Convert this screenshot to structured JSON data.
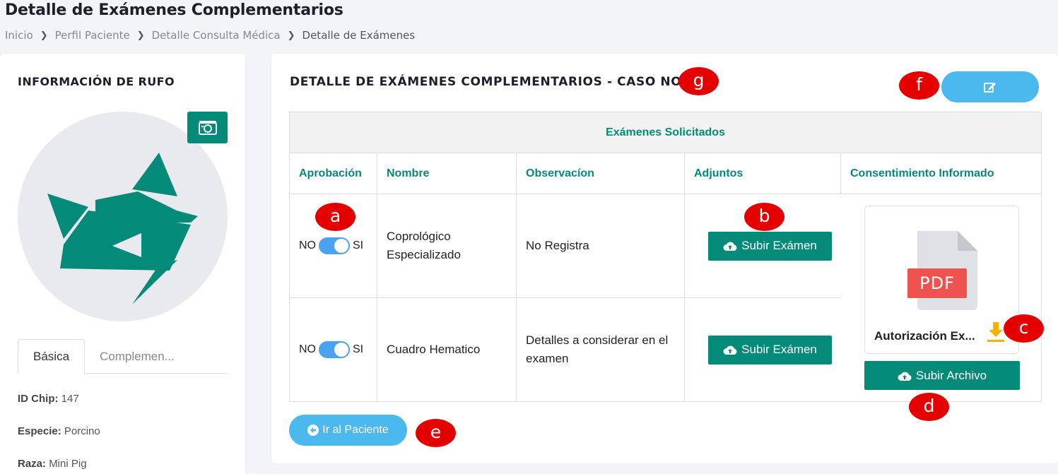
{
  "page": {
    "title": "Detalle de Exámenes Complementarios",
    "breadcrumb": [
      "Inicio",
      "Perfil Paciente",
      "Detalle Consulta Médica",
      "Detalle de Exámenes"
    ]
  },
  "patient": {
    "heading": "INFORMACIÓN DE RUFO",
    "tabs": [
      "Básica",
      "Complemen..."
    ],
    "fields": [
      {
        "label": "ID Chip:",
        "value": "147"
      },
      {
        "label": "Especie:",
        "value": "Porcino"
      },
      {
        "label": "Raza:",
        "value": "Mini Pig"
      }
    ]
  },
  "exams": {
    "heading": "DETALLE DE EXÁMENES COMPLEMENTARIOS - CASO NO. 16",
    "table_title": "Exámenes Solicitados",
    "columns": [
      "Aprobación",
      "Nombre",
      "Observacíon",
      "Adjuntos",
      "Consentimiento Informado"
    ],
    "toggle_no": "NO",
    "toggle_si": "SI",
    "upload_label": "Subir Exámen",
    "rows": [
      {
        "name": "Coprológico Especializado",
        "observation": "No Registra",
        "approved": true
      },
      {
        "name": "Cuadro Hematico",
        "observation": "Detalles a considerar en el examen",
        "approved": true
      }
    ],
    "consent": {
      "badge": "PDF",
      "file_name": "Autorización Ex...",
      "upload_label": "Subir Archivo"
    },
    "back_label": "Ir al Paciente"
  },
  "markers": [
    "a",
    "b",
    "c",
    "d",
    "e",
    "f",
    "g"
  ],
  "colors": {
    "primary": "#048a78",
    "accent": "#4bb8ee",
    "marker": "#e50000",
    "pdf": "#ef5350",
    "download": "#f5b400"
  }
}
